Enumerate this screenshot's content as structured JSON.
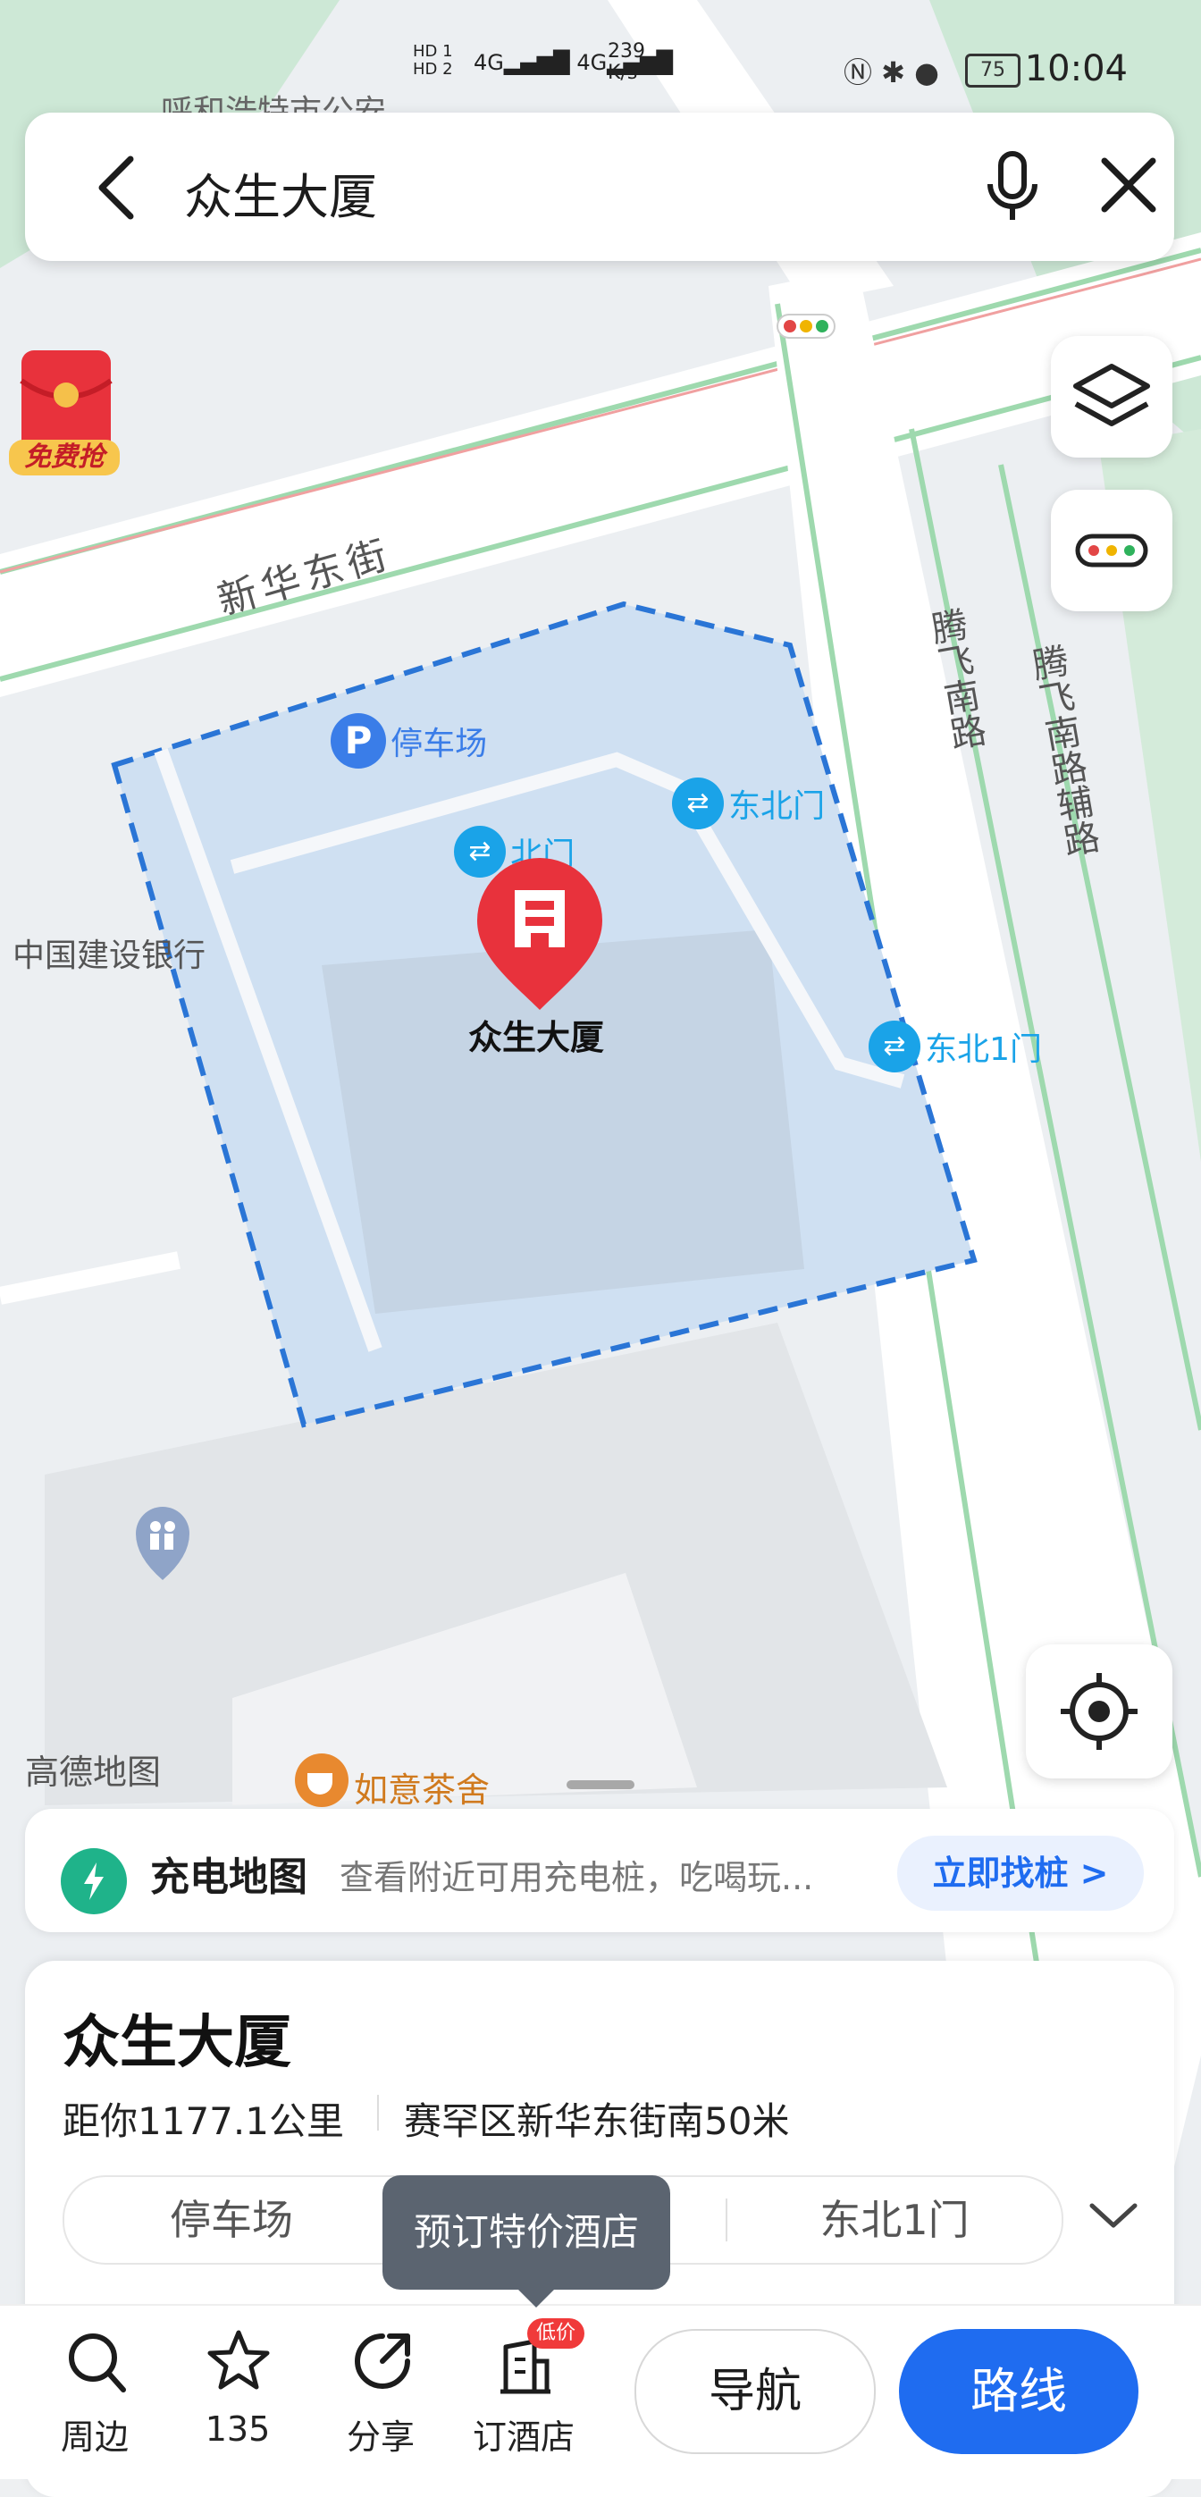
{
  "status_bar": {
    "time": "10:04",
    "battery": "75",
    "net_speed": "239 K/s",
    "sim_labels": [
      "HD 1",
      "HD 2"
    ],
    "signal": "4G"
  },
  "search": {
    "query": "众生大厦"
  },
  "map": {
    "top_fragment_label": "呼和浩特市公安",
    "streets": {
      "xinhua": "新华东街",
      "tengfei_s": "腾飞南路",
      "tengfei_s_aux": "腾飞南路辅路"
    },
    "pois": {
      "parking": "停车场",
      "north_gate": "北门",
      "northeast_gate": "东北门",
      "northeast_gate_1": "东北1门",
      "bank": "中国建设银行",
      "building": "众生大厦",
      "teahouse": "如意茶舍"
    },
    "watermark": "高德地图",
    "promo_badge": "免费抢"
  },
  "charge_banner": {
    "title": "充电地图",
    "subtitle": "查看附近可用充电桩，吃喝玩...",
    "cta": "立即找桩 >"
  },
  "place_card": {
    "name": "众生大厦",
    "distance": "距你1177.1公里",
    "address": "赛罕区新华东街南50米",
    "chips": [
      "停车场",
      "北门",
      "东北1门"
    ]
  },
  "tooltip": "预订特价酒店",
  "bottom_nav": {
    "nearby": "周边",
    "favorites_count": "135",
    "share": "分享",
    "hotel": "订酒店",
    "hotel_badge": "低价",
    "navigate": "导航",
    "route": "路线"
  },
  "colors": {
    "accent": "#1f6cf0",
    "poi_blue": "#1aa3e8",
    "marker_red": "#e8323c",
    "highlight": "#2a75d6"
  }
}
